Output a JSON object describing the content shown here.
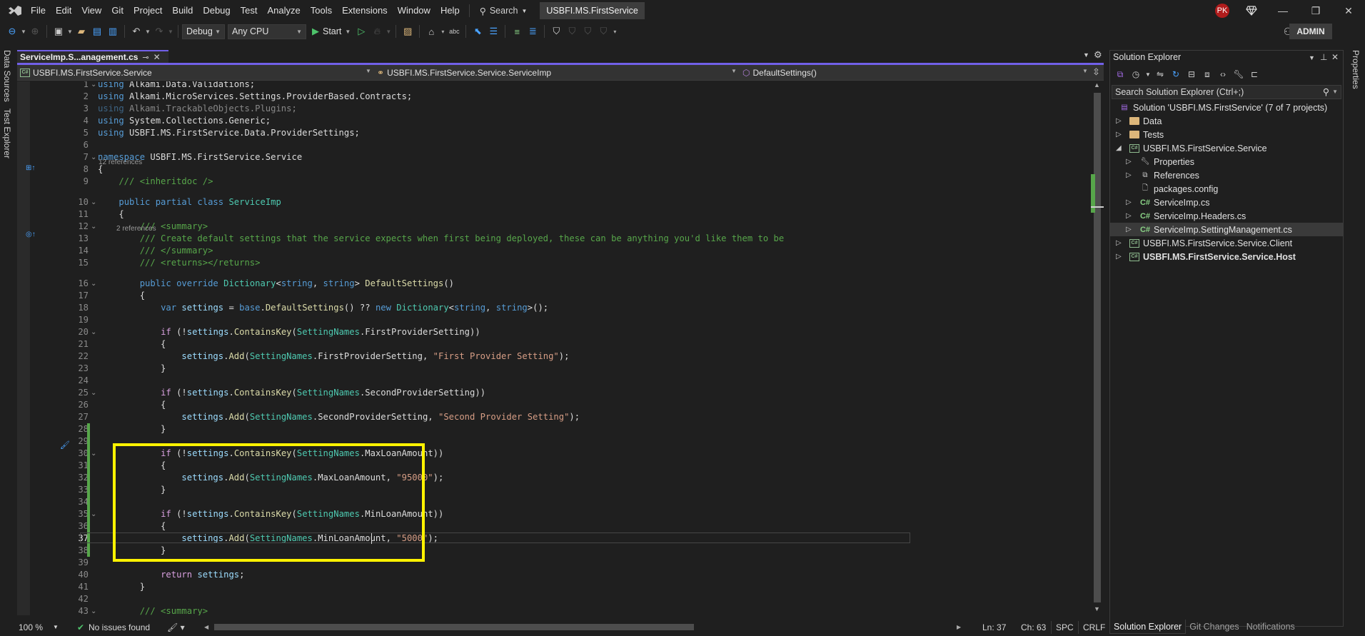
{
  "menubar": {
    "items": [
      "File",
      "Edit",
      "View",
      "Git",
      "Project",
      "Build",
      "Debug",
      "Test",
      "Analyze",
      "Tools",
      "Extensions",
      "Window",
      "Help"
    ],
    "search_label": "Search",
    "solution_name": "USBFI.MS.FirstService",
    "avatar_initials": "PK",
    "window_controls": {
      "minimize": "—",
      "restore": "❐",
      "close": "✕"
    }
  },
  "toolbar": {
    "configuration": "Debug",
    "platform": "Any CPU",
    "start_label": "Start",
    "admin_label": "ADMIN"
  },
  "side_tabs": {
    "left": [
      "Data Sources",
      "Test Explorer"
    ],
    "right": [
      "Properties"
    ]
  },
  "editor": {
    "tab_title": "ServiceImp.S...anagement.cs",
    "nav": {
      "project": "USBFI.MS.FirstService.Service",
      "type": "USBFI.MS.FirstService.Service.ServiceImp",
      "member": "DefaultSettings()"
    },
    "codelens": {
      "class_refs": "12 references",
      "method_refs": "2 references"
    },
    "current_line": 37,
    "highlighted_lines": [
      30,
      38
    ],
    "lines": [
      {
        "n": "1",
        "tokens": [
          [
            "kw",
            "using"
          ],
          [
            "pl",
            " Alkami.Data.Validations;"
          ]
        ]
      },
      {
        "n": "2",
        "tokens": [
          [
            "kw",
            "using"
          ],
          [
            "pl",
            " Alkami.MicroServices.Settings.ProviderBased.Contracts;"
          ]
        ]
      },
      {
        "n": "3",
        "tokens": [
          [
            "kw dim",
            "using"
          ],
          [
            "pl dim",
            " Alkami.TrackableObjects.Plugins;"
          ]
        ]
      },
      {
        "n": "4",
        "tokens": [
          [
            "kw",
            "using"
          ],
          [
            "pl",
            " System.Collections.Generic;"
          ]
        ]
      },
      {
        "n": "5",
        "tokens": [
          [
            "kw",
            "using"
          ],
          [
            "pl",
            " USBFI.MS.FirstService.Data.ProviderSettings;"
          ]
        ]
      },
      {
        "n": "6",
        "tokens": []
      },
      {
        "n": "7",
        "tokens": [
          [
            "kw",
            "namespace"
          ],
          [
            "pl",
            " USBFI.MS.FirstService.Service"
          ]
        ]
      },
      {
        "n": "8",
        "tokens": [
          [
            "pl",
            "{"
          ]
        ]
      },
      {
        "n": "9",
        "tokens": [
          [
            "cm",
            "    /// <inheritdoc />"
          ]
        ]
      },
      {
        "n": "10",
        "tokens": [
          [
            "pl",
            "    "
          ],
          [
            "kw",
            "public partial class"
          ],
          [
            "pl",
            " "
          ],
          [
            "ty",
            "ServiceImp"
          ]
        ]
      },
      {
        "n": "11",
        "tokens": [
          [
            "pl",
            "    {"
          ]
        ]
      },
      {
        "n": "12",
        "tokens": [
          [
            "cm",
            "        /// <summary>"
          ]
        ]
      },
      {
        "n": "13",
        "tokens": [
          [
            "cm",
            "        /// Create default settings that the service expects when first being deployed, these can be anything you'd like them to be"
          ]
        ]
      },
      {
        "n": "14",
        "tokens": [
          [
            "cm",
            "        /// </summary>"
          ]
        ]
      },
      {
        "n": "15",
        "tokens": [
          [
            "cm",
            "        /// <returns></returns>"
          ]
        ]
      },
      {
        "n": "16",
        "tokens": [
          [
            "pl",
            "        "
          ],
          [
            "kw",
            "public override"
          ],
          [
            "pl",
            " "
          ],
          [
            "ty",
            "Dictionary"
          ],
          [
            "pl",
            "<"
          ],
          [
            "kw",
            "string"
          ],
          [
            "pl",
            ", "
          ],
          [
            "kw",
            "string"
          ],
          [
            "pl",
            "> "
          ],
          [
            "fn",
            "DefaultSettings"
          ],
          [
            "pl",
            "()"
          ]
        ]
      },
      {
        "n": "17",
        "tokens": [
          [
            "pl",
            "        {"
          ]
        ]
      },
      {
        "n": "18",
        "tokens": [
          [
            "pl",
            "            "
          ],
          [
            "kw",
            "var"
          ],
          [
            "pl",
            " "
          ],
          [
            "var",
            "settings"
          ],
          [
            "pl",
            " = "
          ],
          [
            "kw",
            "base"
          ],
          [
            "pl",
            "."
          ],
          [
            "fn",
            "DefaultSettings"
          ],
          [
            "pl",
            "() ?? "
          ],
          [
            "kw",
            "new"
          ],
          [
            "pl",
            " "
          ],
          [
            "ty",
            "Dictionary"
          ],
          [
            "pl",
            "<"
          ],
          [
            "kw",
            "string"
          ],
          [
            "pl",
            ", "
          ],
          [
            "kw",
            "string"
          ],
          [
            "pl",
            ">();"
          ]
        ]
      },
      {
        "n": "19",
        "tokens": []
      },
      {
        "n": "20",
        "tokens": [
          [
            "pl",
            "            "
          ],
          [
            "ctl",
            "if"
          ],
          [
            "pl",
            " (!"
          ],
          [
            "var",
            "settings"
          ],
          [
            "pl",
            "."
          ],
          [
            "fn",
            "ContainsKey"
          ],
          [
            "pl",
            "("
          ],
          [
            "ty",
            "SettingNames"
          ],
          [
            "pl",
            ".FirstProviderSetting))"
          ]
        ]
      },
      {
        "n": "21",
        "tokens": [
          [
            "pl",
            "            {"
          ]
        ]
      },
      {
        "n": "22",
        "tokens": [
          [
            "pl",
            "                "
          ],
          [
            "var",
            "settings"
          ],
          [
            "pl",
            "."
          ],
          [
            "fn",
            "Add"
          ],
          [
            "pl",
            "("
          ],
          [
            "ty",
            "SettingNames"
          ],
          [
            "pl",
            ".FirstProviderSetting, "
          ],
          [
            "str",
            "\"First Provider Setting\""
          ],
          [
            "pl",
            ");"
          ]
        ]
      },
      {
        "n": "23",
        "tokens": [
          [
            "pl",
            "            }"
          ]
        ]
      },
      {
        "n": "24",
        "tokens": []
      },
      {
        "n": "25",
        "tokens": [
          [
            "pl",
            "            "
          ],
          [
            "ctl",
            "if"
          ],
          [
            "pl",
            " (!"
          ],
          [
            "var",
            "settings"
          ],
          [
            "pl",
            "."
          ],
          [
            "fn",
            "ContainsKey"
          ],
          [
            "pl",
            "("
          ],
          [
            "ty",
            "SettingNames"
          ],
          [
            "pl",
            ".SecondProviderSetting))"
          ]
        ]
      },
      {
        "n": "26",
        "tokens": [
          [
            "pl",
            "            {"
          ]
        ]
      },
      {
        "n": "27",
        "tokens": [
          [
            "pl",
            "                "
          ],
          [
            "var",
            "settings"
          ],
          [
            "pl",
            "."
          ],
          [
            "fn",
            "Add"
          ],
          [
            "pl",
            "("
          ],
          [
            "ty",
            "SettingNames"
          ],
          [
            "pl",
            ".SecondProviderSetting, "
          ],
          [
            "str",
            "\"Second Provider Setting\""
          ],
          [
            "pl",
            ");"
          ]
        ]
      },
      {
        "n": "28",
        "tokens": [
          [
            "pl",
            "            }"
          ]
        ]
      },
      {
        "n": "29",
        "tokens": []
      },
      {
        "n": "30",
        "tokens": [
          [
            "pl",
            "            "
          ],
          [
            "ctl",
            "if"
          ],
          [
            "pl",
            " (!"
          ],
          [
            "var",
            "settings"
          ],
          [
            "pl",
            "."
          ],
          [
            "fn",
            "ContainsKey"
          ],
          [
            "pl",
            "("
          ],
          [
            "ty",
            "SettingNames"
          ],
          [
            "pl",
            ".MaxLoanAmount))"
          ]
        ]
      },
      {
        "n": "31",
        "tokens": [
          [
            "pl",
            "            {"
          ]
        ]
      },
      {
        "n": "32",
        "tokens": [
          [
            "pl",
            "                "
          ],
          [
            "var",
            "settings"
          ],
          [
            "pl",
            "."
          ],
          [
            "fn",
            "Add"
          ],
          [
            "pl",
            "("
          ],
          [
            "ty",
            "SettingNames"
          ],
          [
            "pl",
            ".MaxLoanAmount, "
          ],
          [
            "str",
            "\"95000\""
          ],
          [
            "pl",
            ");"
          ]
        ]
      },
      {
        "n": "33",
        "tokens": [
          [
            "pl",
            "            }"
          ]
        ]
      },
      {
        "n": "34",
        "tokens": []
      },
      {
        "n": "35",
        "tokens": [
          [
            "pl",
            "            "
          ],
          [
            "ctl",
            "if"
          ],
          [
            "pl",
            " (!"
          ],
          [
            "var",
            "settings"
          ],
          [
            "pl",
            "."
          ],
          [
            "fn",
            "ContainsKey"
          ],
          [
            "pl",
            "("
          ],
          [
            "ty",
            "SettingNames"
          ],
          [
            "pl",
            ".MinLoanAmount))"
          ]
        ]
      },
      {
        "n": "36",
        "tokens": [
          [
            "pl",
            "            {"
          ]
        ]
      },
      {
        "n": "37",
        "tokens": [
          [
            "pl",
            "                "
          ],
          [
            "var",
            "settings"
          ],
          [
            "pl",
            "."
          ],
          [
            "fn",
            "Add"
          ],
          [
            "pl",
            "("
          ],
          [
            "ty",
            "SettingNames"
          ],
          [
            "pl",
            ".MinLoanAmount, "
          ],
          [
            "str",
            "\"5000\""
          ],
          [
            "pl",
            ");"
          ]
        ]
      },
      {
        "n": "38",
        "tokens": [
          [
            "pl",
            "            }"
          ]
        ]
      },
      {
        "n": "39",
        "tokens": []
      },
      {
        "n": "40",
        "tokens": [
          [
            "pl",
            "            "
          ],
          [
            "ctl",
            "return"
          ],
          [
            "pl",
            " "
          ],
          [
            "var",
            "settings"
          ],
          [
            "pl",
            ";"
          ]
        ]
      },
      {
        "n": "41",
        "tokens": [
          [
            "pl",
            "        }"
          ]
        ]
      },
      {
        "n": "42",
        "tokens": []
      },
      {
        "n": "43",
        "tokens": [
          [
            "cm",
            "        /// <summary>"
          ]
        ]
      }
    ]
  },
  "statusbar": {
    "zoom": "100 %",
    "issues": "No issues found",
    "line": "Ln: 37",
    "col": "Ch: 63",
    "indent": "SPC",
    "eol": "CRLF"
  },
  "solution_explorer": {
    "title": "Solution Explorer",
    "search_placeholder": "Search Solution Explorer (Ctrl+;)",
    "tree": [
      {
        "label": "Solution 'USBFI.MS.FirstService' (7 of 7 projects)",
        "icon": "solution-icon",
        "depth": 0,
        "twisty": ""
      },
      {
        "label": "Data",
        "icon": "folder-icon",
        "depth": 1,
        "twisty": "collapsed"
      },
      {
        "label": "Tests",
        "icon": "folder-icon",
        "depth": 1,
        "twisty": "collapsed"
      },
      {
        "label": "USBFI.MS.FirstService.Service",
        "icon": "csproj-icon",
        "depth": 1,
        "twisty": "expanded"
      },
      {
        "label": "Properties",
        "icon": "wrench-icon",
        "depth": 2,
        "twisty": "collapsed"
      },
      {
        "label": "References",
        "icon": "references-icon",
        "depth": 2,
        "twisty": "collapsed"
      },
      {
        "label": "packages.config",
        "icon": "config-file-icon",
        "depth": 2,
        "twisty": ""
      },
      {
        "label": "ServiceImp.cs",
        "icon": "csharp-file-icon",
        "depth": 2,
        "twisty": "collapsed"
      },
      {
        "label": "ServiceImp.Headers.cs",
        "icon": "csharp-file-icon",
        "depth": 2,
        "twisty": "collapsed"
      },
      {
        "label": "ServiceImp.SettingManagement.cs",
        "icon": "csharp-file-icon",
        "depth": 2,
        "twisty": "collapsed",
        "selected": true
      },
      {
        "label": "USBFI.MS.FirstService.Service.Client",
        "icon": "csproj-icon",
        "depth": 1,
        "twisty": "collapsed"
      },
      {
        "label": "USBFI.MS.FirstService.Service.Host",
        "icon": "csproj-icon",
        "depth": 1,
        "twisty": "collapsed",
        "bold": true
      }
    ],
    "bottom_tabs": [
      "Solution Explorer",
      "Git Changes",
      "Notifications"
    ]
  },
  "colors": {
    "accent": "#7160e8",
    "highlight_box": "#fff200",
    "change_bar": "#57a64a",
    "avatar_bg": "#b01c1c"
  }
}
